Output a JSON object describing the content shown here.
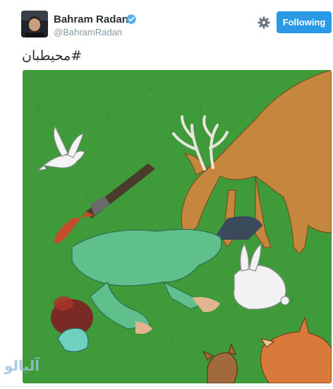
{
  "tweet": {
    "author_name": "Bahram Radan",
    "author_handle": "@BahramRadan",
    "follow_label": "Following",
    "text": "#محیطبان"
  },
  "icons": {
    "verified": "verified-badge-icon",
    "settings": "gear-icon"
  },
  "colors": {
    "follow_button": "#2b9ae6",
    "verified": "#55acee",
    "grass": "#3f9b3a"
  },
  "watermark": {
    "text": "آلبالو"
  }
}
